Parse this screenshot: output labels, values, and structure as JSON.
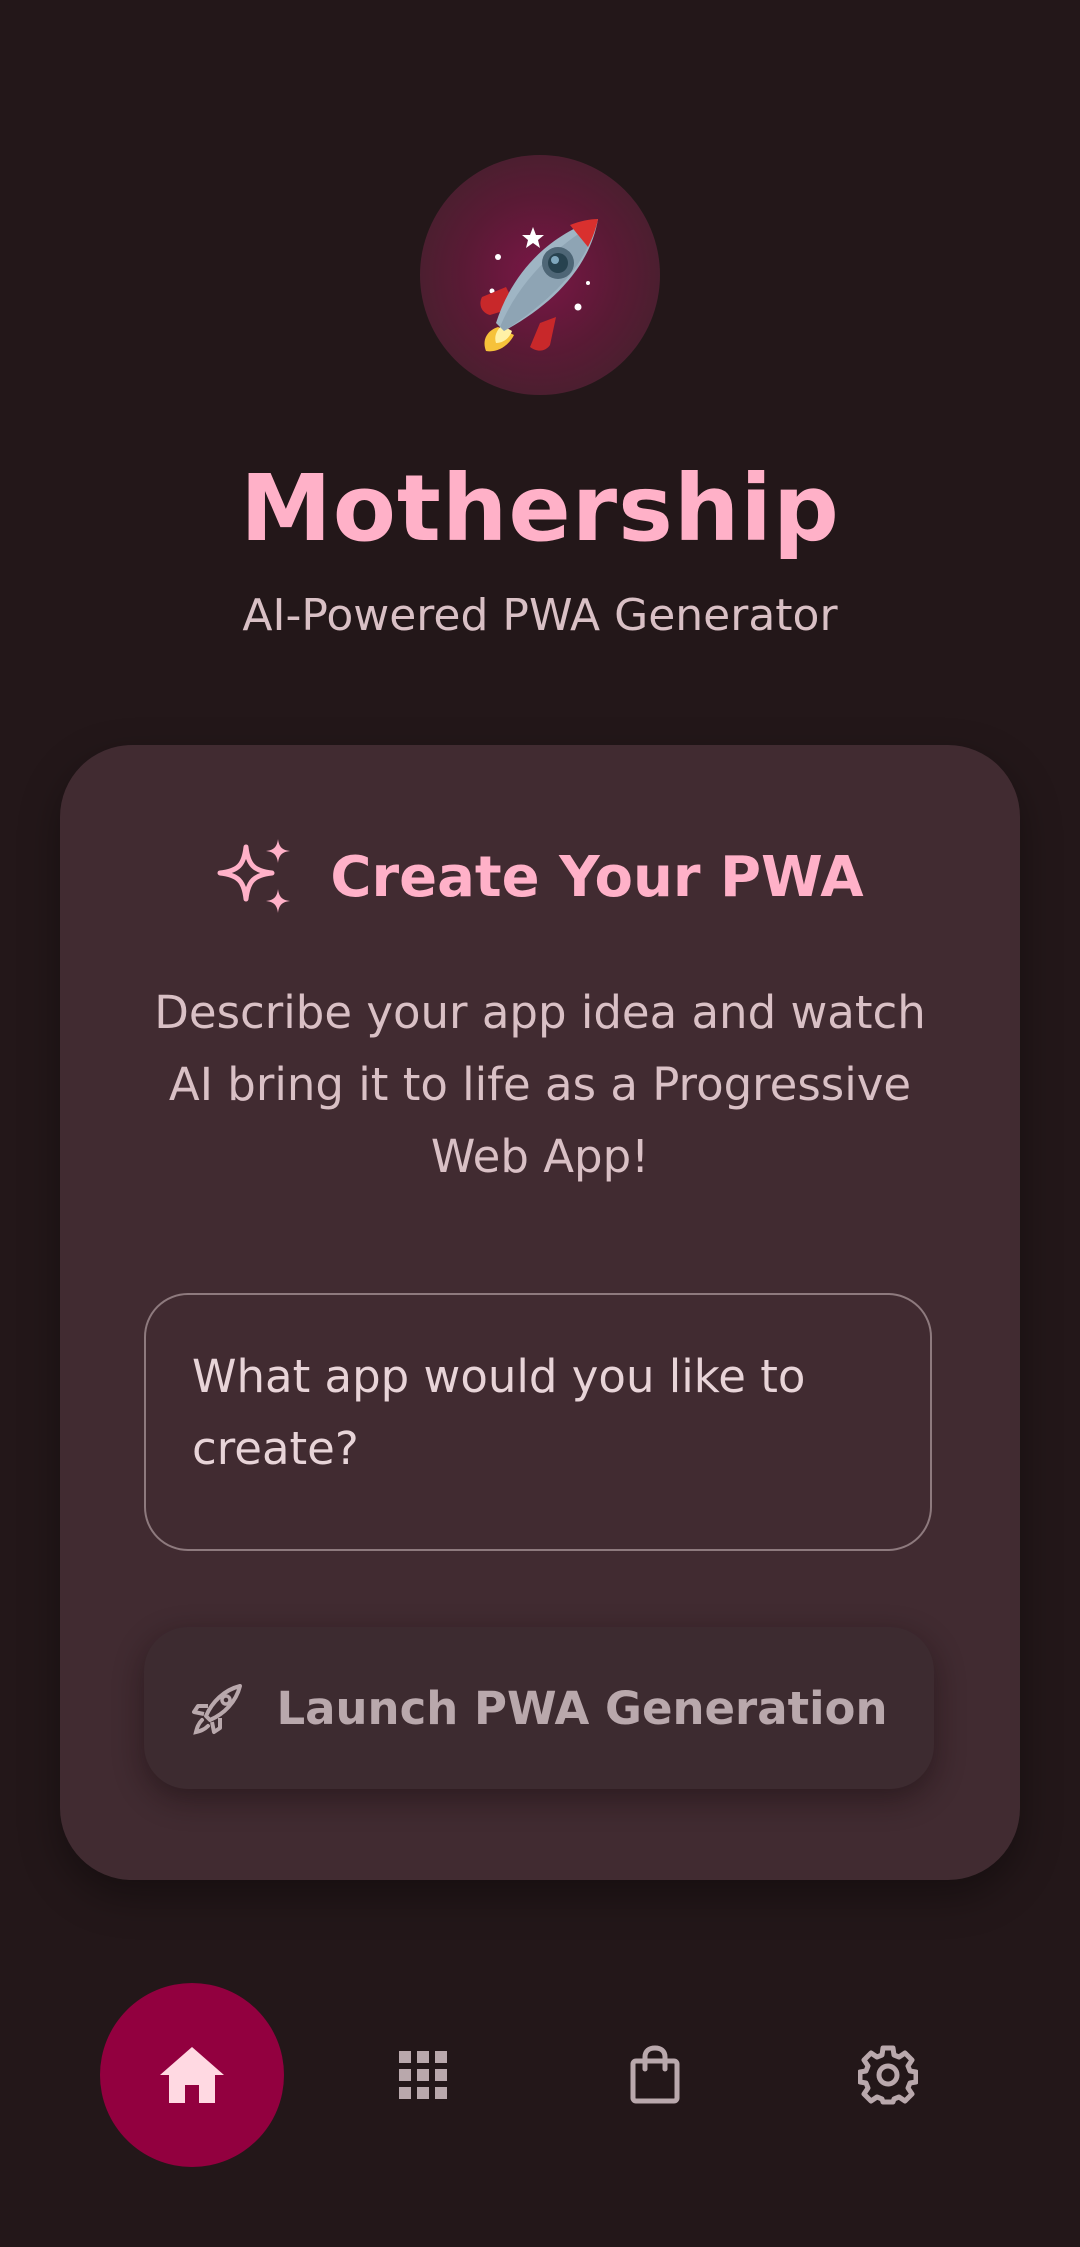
{
  "app": {
    "logo_icon": "rocket-icon",
    "title": "Mothership",
    "subtitle": "AI-Powered PWA Generator"
  },
  "card": {
    "title_icon": "sparkles-icon",
    "title": "Create Your PWA",
    "description": "Describe your app idea and watch AI bring it to life as a Progressive Web App!",
    "prompt": {
      "placeholder": "What app would you like to create?",
      "value": ""
    },
    "launch_button": {
      "icon": "rocket-outline-icon",
      "label": "Launch PWA Generation"
    }
  },
  "bottom_nav": {
    "items": [
      {
        "id": "home",
        "icon": "home-icon",
        "active": true
      },
      {
        "id": "apps",
        "icon": "grid-icon",
        "active": false
      },
      {
        "id": "store",
        "icon": "shopping-bag-icon",
        "active": false
      },
      {
        "id": "settings",
        "icon": "gear-icon",
        "active": false
      }
    ]
  },
  "colors": {
    "background": "#231719",
    "card": "#412b31",
    "accent": "#ffb1c8",
    "active_nav": "#92003f",
    "text_secondary": "#d9c0c5"
  }
}
